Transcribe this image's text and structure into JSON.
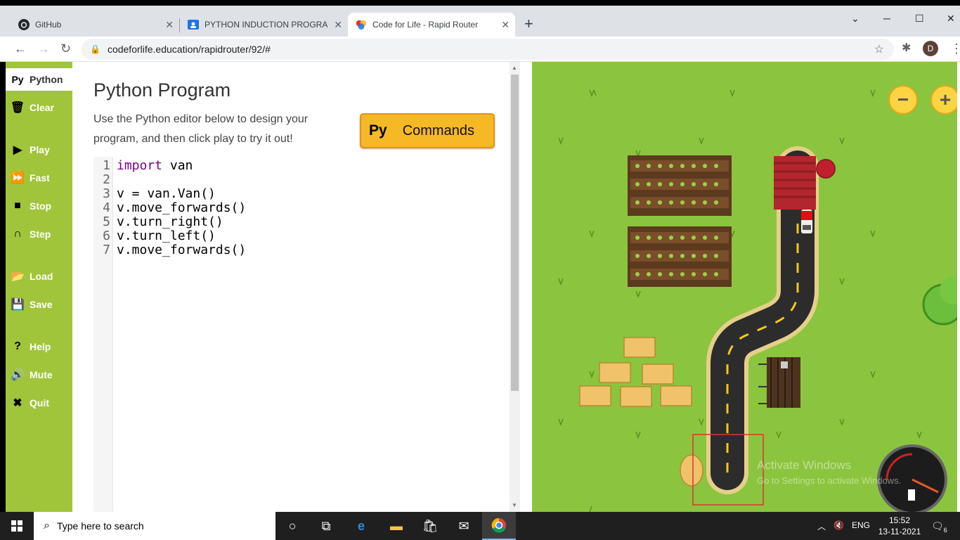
{
  "browser": {
    "tabs": [
      {
        "title": "GitHub",
        "icon": "github-icon"
      },
      {
        "title": "PYTHON INDUCTION PROGRAM",
        "icon": "classroom-icon"
      },
      {
        "title": "Code for Life - Rapid Router",
        "icon": "codeforlife-icon",
        "active": true
      }
    ],
    "new_tab": "+",
    "window_controls": {
      "minimize": "─",
      "maximize": "☐",
      "close": "✕",
      "tab_search": "⌄"
    },
    "url": "codeforlife.education/rapidrouter/92/#",
    "profile_initial": "D"
  },
  "sidebar": {
    "items": [
      {
        "label": "Python",
        "icon": "Py",
        "active": true
      },
      {
        "label": "Clear",
        "icon": "🗑"
      },
      {
        "label": "Play",
        "icon": "▶"
      },
      {
        "label": "Fast",
        "icon": "⏩"
      },
      {
        "label": "Stop",
        "icon": "■"
      },
      {
        "label": "Step",
        "icon": "∩"
      },
      {
        "label": "Load",
        "icon": "📂"
      },
      {
        "label": "Save",
        "icon": "💾"
      },
      {
        "label": "Help",
        "icon": "?"
      },
      {
        "label": "Mute",
        "icon": "🔊"
      },
      {
        "label": "Quit",
        "icon": "✖"
      }
    ]
  },
  "editor": {
    "title": "Python Program",
    "description": "Use the Python editor below to design your program, and then click play to try it out!",
    "commands_button": {
      "badge": "Py",
      "label": "Commands"
    },
    "line_numbers": [
      "1",
      "2",
      "3",
      "4",
      "5",
      "6",
      "7"
    ],
    "lines": [
      {
        "kw": "import",
        "rest": " van"
      },
      {
        "kw": "",
        "rest": ""
      },
      {
        "kw": "",
        "rest": "v = van.Van()"
      },
      {
        "kw": "",
        "rest": "v.move_forwards()"
      },
      {
        "kw": "",
        "rest": "v.turn_right()"
      },
      {
        "kw": "",
        "rest": "v.turn_left()"
      },
      {
        "kw": "",
        "rest": "v.move_forwards()"
      }
    ]
  },
  "map": {
    "zoom_out": "−",
    "zoom_in": "+",
    "watermark_title": "Activate Windows",
    "watermark_sub": "Go to Settings to activate Windows."
  },
  "taskbar": {
    "search_placeholder": "Type here to search",
    "language": "ENG",
    "time": "15:52",
    "date": "13-11-2021",
    "notifications": "6"
  }
}
